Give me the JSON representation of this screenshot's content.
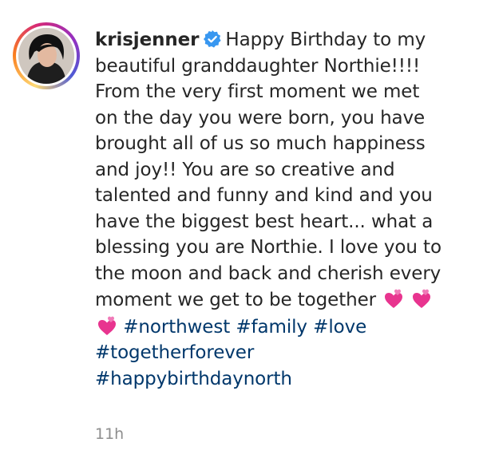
{
  "post": {
    "username": "krisjenner",
    "verified_icon": "verified-badge-icon",
    "caption_lines": [
      "Happy Birthday to my",
      "beautiful granddaughter Northie!!!!",
      "From the very first moment we met",
      "on the day you were born, you have",
      "brought all of us so much happiness",
      "and joy!! You are so creative and",
      "talented and funny and kind and you",
      "have the biggest best heart... what a",
      "blessing you are Northie. I love you to",
      "the moon and back and cherish every",
      "moment we get to be together"
    ],
    "emoji_icon": "two-pink-hearts-emoji",
    "hashtags": [
      "#northwest",
      "#family",
      "#love",
      "#togetherforever",
      "#happybirthdaynorth"
    ],
    "timestamp": "11h",
    "colors": {
      "text": "#262626",
      "hashtag": "#00376b",
      "timestamp": "#8e8e8e",
      "verified": "#3897f0"
    }
  }
}
